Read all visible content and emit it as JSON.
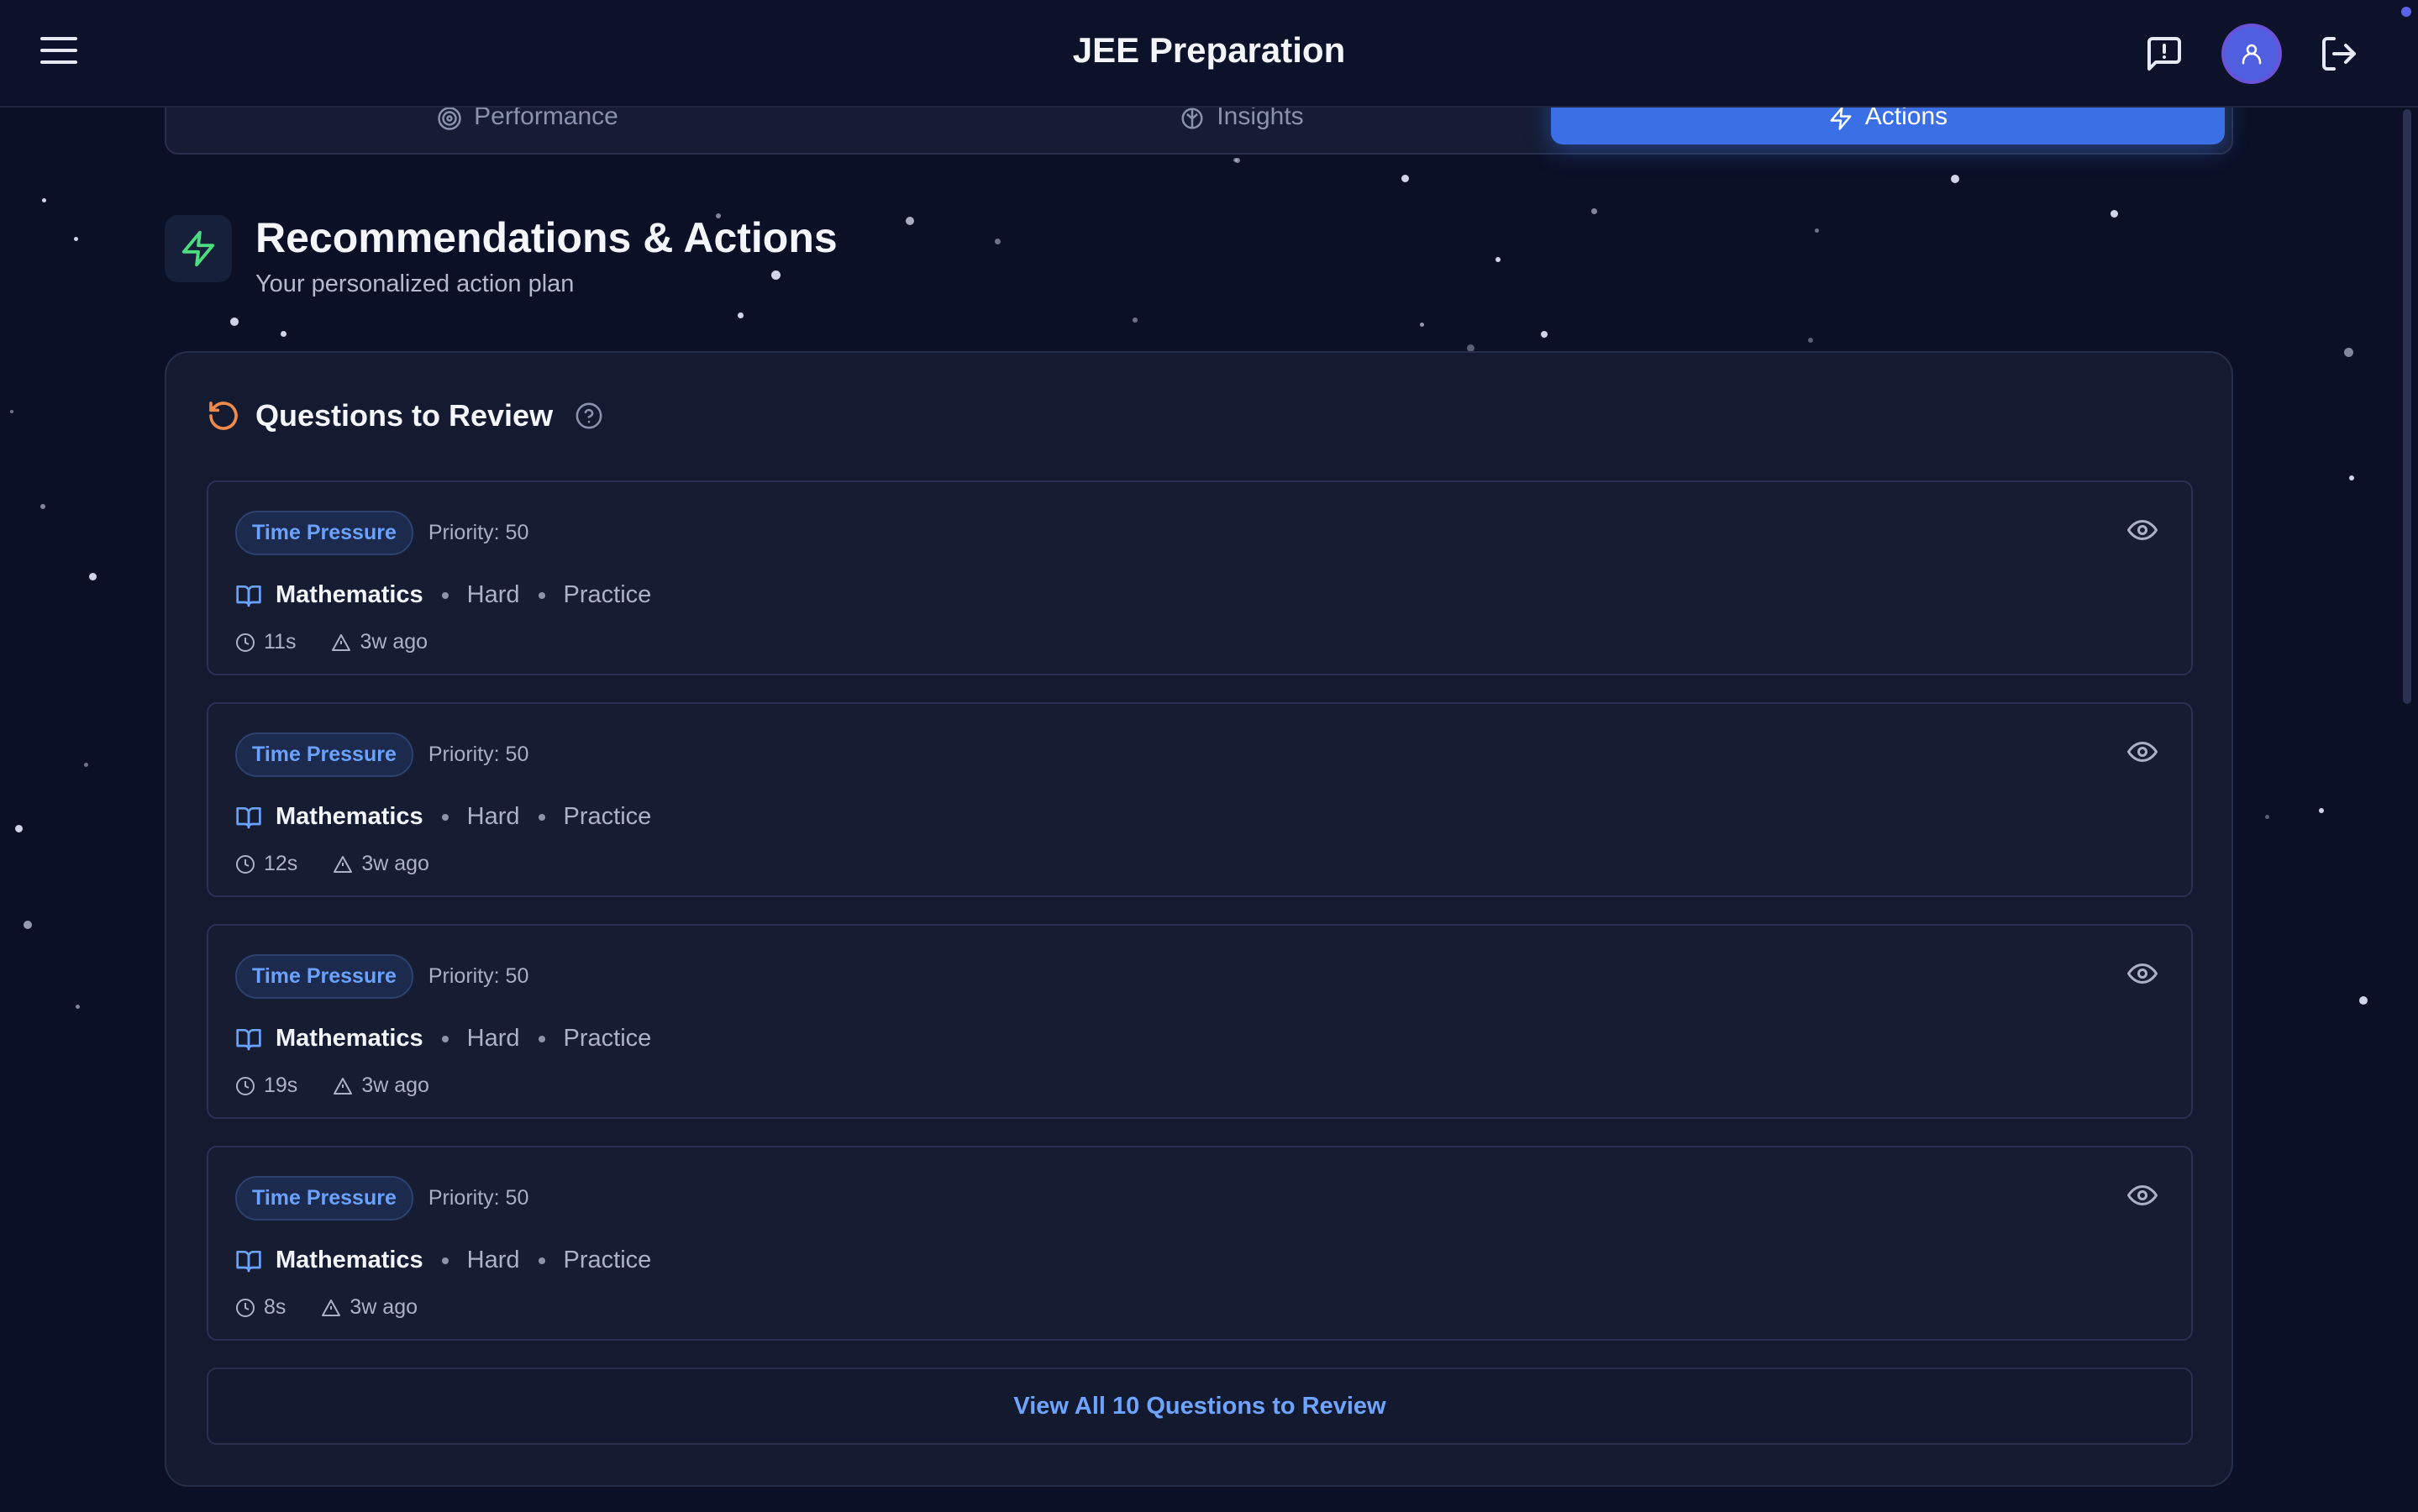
{
  "header": {
    "title": "JEE Preparation",
    "menu_icon": "hamburger-menu-icon",
    "feedback_icon": "message-alert-icon",
    "avatar_icon": "user-icon",
    "logout_icon": "logout-icon"
  },
  "tabs": [
    {
      "label": "Performance",
      "icon": "target-icon",
      "active": false
    },
    {
      "label": "Insights",
      "icon": "brain-icon",
      "active": false
    },
    {
      "label": "Actions",
      "icon": "zap-icon",
      "active": true
    }
  ],
  "section": {
    "title": "Recommendations & Actions",
    "subtitle": "Your personalized action plan",
    "icon": "zap-icon"
  },
  "review": {
    "title": "Questions to Review",
    "icon": "rotate-ccw-icon",
    "help_icon": "help-circle-icon",
    "items": [
      {
        "badge": "Time Pressure",
        "priority": "Priority: 50",
        "subject": "Mathematics",
        "difficulty": "Hard",
        "mode": "Practice",
        "time": "11s",
        "ago": "3w ago"
      },
      {
        "badge": "Time Pressure",
        "priority": "Priority: 50",
        "subject": "Mathematics",
        "difficulty": "Hard",
        "mode": "Practice",
        "time": "12s",
        "ago": "3w ago"
      },
      {
        "badge": "Time Pressure",
        "priority": "Priority: 50",
        "subject": "Mathematics",
        "difficulty": "Hard",
        "mode": "Practice",
        "time": "19s",
        "ago": "3w ago"
      },
      {
        "badge": "Time Pressure",
        "priority": "Priority: 50",
        "subject": "Mathematics",
        "difficulty": "Hard",
        "mode": "Practice",
        "time": "8s",
        "ago": "3w ago"
      }
    ],
    "view_all_label": "View All 10 Questions to Review"
  },
  "colors": {
    "background": "#0b1026",
    "accent": "#3b6fe6",
    "badge_text": "#6aa2ff",
    "review_icon": "#f08a4b",
    "bolt_icon": "#4ade80"
  }
}
